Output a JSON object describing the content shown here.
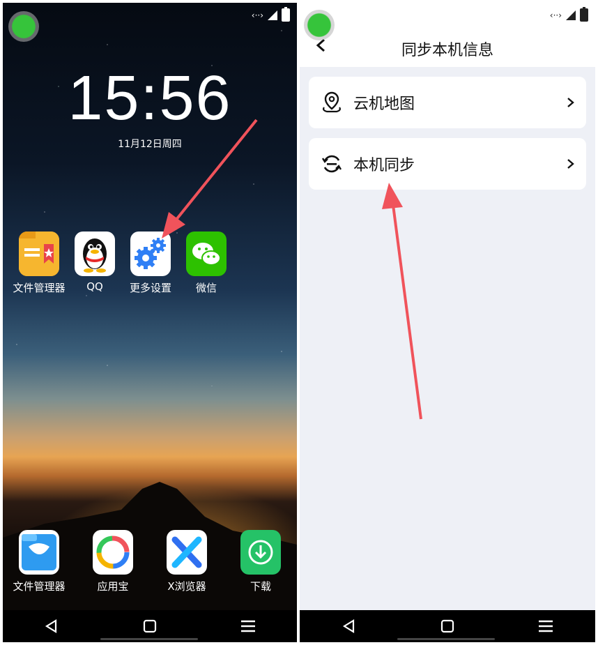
{
  "left_screen": {
    "time": "15:56",
    "date": "11月12日周四",
    "apps_row1": [
      {
        "label": "文件管理器",
        "icon": "folder-icon"
      },
      {
        "label": "QQ",
        "icon": "qq-penguin-icon"
      },
      {
        "label": "更多设置",
        "icon": "gears-icon"
      },
      {
        "label": "微信",
        "icon": "wechat-icon"
      }
    ],
    "dock": [
      {
        "label": "文件管理器",
        "icon": "es-file-icon"
      },
      {
        "label": "应用宝",
        "icon": "yingyongbao-icon"
      },
      {
        "label": "X浏览器",
        "icon": "x-browser-icon"
      },
      {
        "label": "下载",
        "icon": "download-icon"
      }
    ],
    "status": {
      "network": "‹··›"
    }
  },
  "right_screen": {
    "title": "同步本机信息",
    "status": {
      "network": "‹··›"
    },
    "items": [
      {
        "label": "云机地图",
        "icon": "map-pin-icon"
      },
      {
        "label": "本机同步",
        "icon": "sync-icon"
      }
    ]
  },
  "colors": {
    "accent_red": "#f0535b",
    "float_green": "#36c43b",
    "settings_blue": "#2f7ff5",
    "wechat_green": "#2dc100",
    "download_green": "#25c267"
  }
}
